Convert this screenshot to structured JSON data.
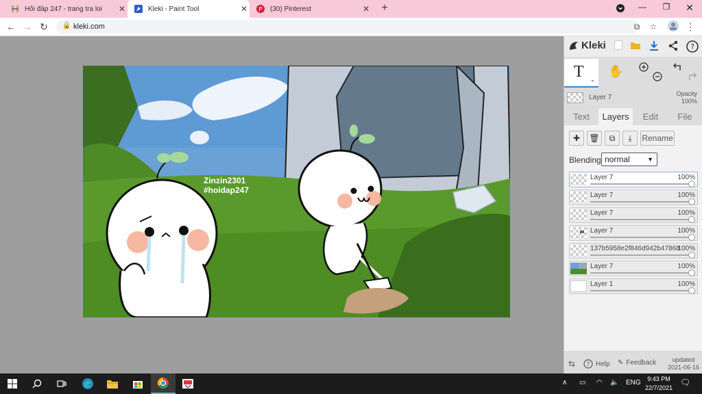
{
  "browser": {
    "tabs": [
      {
        "title": "Hỏi đáp 247 - trang tra loi",
        "icon": "hoidap-favicon",
        "active": false
      },
      {
        "title": "Kleki - Paint Tool",
        "icon": "kleki-favicon",
        "active": true
      },
      {
        "title": "(30) Pinterest",
        "icon": "pinterest-favicon",
        "active": false
      }
    ],
    "new_tab_label": "+",
    "url": "kleki.com"
  },
  "canvas": {
    "watermark_line1": "Zinzin2301",
    "watermark_line2": "#hoidap247"
  },
  "panel": {
    "app_name": "Kleki",
    "current_layer_name": "Layer 7",
    "opacity_label": "Opacity",
    "opacity_value": "100%",
    "tabs": [
      "Text",
      "Layers",
      "Edit",
      "File"
    ],
    "active_tab": "Layers",
    "rename_label": "Rename",
    "blending_label": "Blending",
    "blending_value": "normal",
    "layers": [
      {
        "name": "Layer 7",
        "opacity": "100%",
        "selected": true
      },
      {
        "name": "Layer 7",
        "opacity": "100%",
        "selected": false
      },
      {
        "name": "Layer 7",
        "opacity": "100%",
        "selected": false
      },
      {
        "name": "Layer 7",
        "opacity": "100%",
        "selected": false
      },
      {
        "name": "137b5958e2f846d942b47868",
        "opacity": "100%",
        "selected": false
      },
      {
        "name": "Layer 7",
        "opacity": "100%",
        "selected": false
      },
      {
        "name": "Layer 1",
        "opacity": "100%",
        "selected": false
      }
    ],
    "help_label": "Help",
    "feedback_label": "Feedback",
    "updated_label": "updated",
    "updated_date": "2021-06-16"
  },
  "taskbar": {
    "language": "ENG",
    "time": "9:43 PM",
    "date": "22/7/2021"
  }
}
